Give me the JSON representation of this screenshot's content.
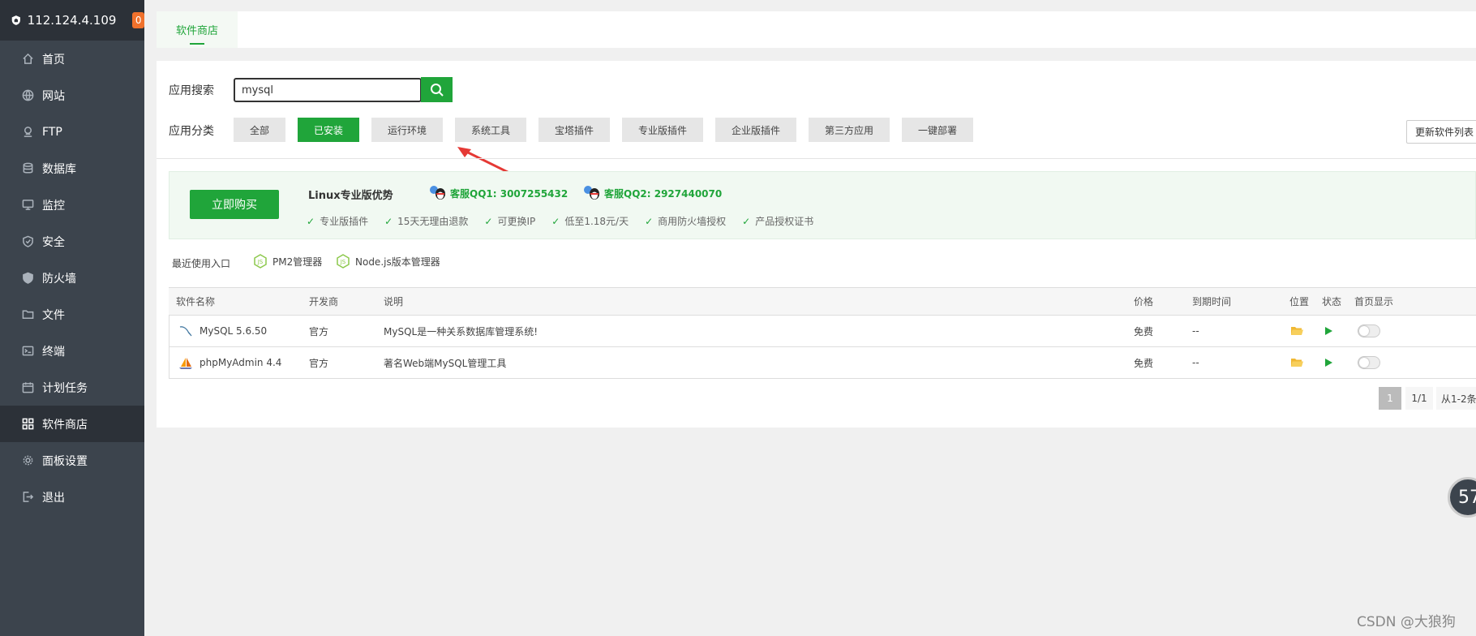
{
  "server": {
    "ip": "112.124.4.109",
    "badge_count": "0"
  },
  "sidebar": {
    "items": [
      {
        "label": "首页",
        "icon": "home-icon"
      },
      {
        "label": "网站",
        "icon": "globe-icon"
      },
      {
        "label": "FTP",
        "icon": "ftp-icon"
      },
      {
        "label": "数据库",
        "icon": "database-icon"
      },
      {
        "label": "监控",
        "icon": "monitor-icon"
      },
      {
        "label": "安全",
        "icon": "shield-check-icon"
      },
      {
        "label": "防火墙",
        "icon": "firewall-icon"
      },
      {
        "label": "文件",
        "icon": "folder-icon"
      },
      {
        "label": "终端",
        "icon": "terminal-icon"
      },
      {
        "label": "计划任务",
        "icon": "calendar-icon"
      },
      {
        "label": "软件商店",
        "icon": "grid-icon",
        "active": true
      },
      {
        "label": "面板设置",
        "icon": "gear-icon"
      },
      {
        "label": "退出",
        "icon": "logout-icon"
      }
    ]
  },
  "tab": {
    "label": "软件商店"
  },
  "search": {
    "label": "应用搜索",
    "value": "mysql"
  },
  "category": {
    "label": "应用分类",
    "items": [
      "全部",
      "已安装",
      "运行环境",
      "系统工具",
      "宝塔插件",
      "专业版插件",
      "企业版插件",
      "第三方应用",
      "一键部署"
    ],
    "active_index": 1
  },
  "refresh_label": "更新软件列表",
  "promo": {
    "buy_label": "立即购买",
    "title": "Linux专业版优势",
    "qq1": "客服QQ1: 3007255432",
    "qq2": "客服QQ2: 2927440070",
    "features": [
      "专业版插件",
      "15天无理由退款",
      "可更换IP",
      "低至1.18元/天",
      "商用防火墙授权",
      "产品授权证书"
    ]
  },
  "recent": {
    "label": "最近使用入口",
    "items": [
      "PM2管理器",
      "Node.js版本管理器"
    ]
  },
  "table": {
    "headers": [
      "软件名称",
      "开发商",
      "说明",
      "价格",
      "到期时间",
      "位置",
      "状态",
      "首页显示"
    ],
    "rows": [
      {
        "name": "MySQL 5.6.50",
        "vendor": "官方",
        "desc": "MySQL是一种关系数据库管理系统!",
        "price": "免费",
        "expire": "--"
      },
      {
        "name": "phpMyAdmin 4.4",
        "vendor": "官方",
        "desc": "著名Web端MySQL管理工具",
        "price": "免费",
        "expire": "--"
      }
    ]
  },
  "pager": {
    "current": "1",
    "total": "1/1",
    "range": "从1-2条"
  },
  "float_widget": {
    "value": "57"
  },
  "watermark": "CSDN @大狼狗",
  "colors": {
    "accent": "#20a53a",
    "sidebar_bg": "#3c444d",
    "sidebar_dark": "#2c3138",
    "badge": "#f0712c"
  }
}
